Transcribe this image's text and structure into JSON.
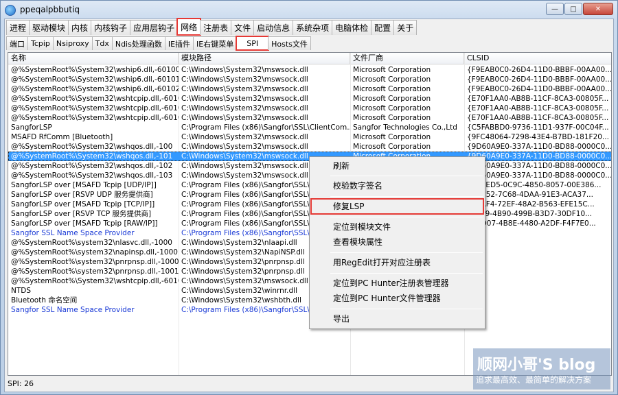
{
  "window": {
    "title": "ppeqalpbbutiq",
    "minimize": "—",
    "maximize": "□",
    "close": "✕"
  },
  "main_tabs": [
    {
      "label": "进程"
    },
    {
      "label": "驱动模块"
    },
    {
      "label": "内核"
    },
    {
      "label": "内核钩子"
    },
    {
      "label": "应用层钩子"
    },
    {
      "label": "网络"
    },
    {
      "label": "注册表"
    },
    {
      "label": "文件"
    },
    {
      "label": "启动信息"
    },
    {
      "label": "系统杂项"
    },
    {
      "label": "电脑体检"
    },
    {
      "label": "配置"
    },
    {
      "label": "关于"
    }
  ],
  "network_tabs": [
    {
      "label": "端口"
    },
    {
      "label": "Tcpip"
    },
    {
      "label": "Nsiproxy"
    },
    {
      "label": "Tdx"
    },
    {
      "label": "Ndis处理函数"
    },
    {
      "label": "IE插件"
    },
    {
      "label": "IE右键菜单"
    },
    {
      "label": "SPI"
    },
    {
      "label": "Hosts文件"
    }
  ],
  "table": {
    "columns": [
      "名称",
      "模块路径",
      "文件厂商",
      "CLSID"
    ],
    "rows": [
      [
        "@%SystemRoot%\\System32\\wship6.dll,-60100",
        "C:\\Windows\\System32\\mswsock.dll",
        "Microsoft Corporation",
        "{F9EAB0C0-26D4-11D0-BBBF-00AA00..."
      ],
      [
        "@%SystemRoot%\\System32\\wship6.dll,-60101",
        "C:\\Windows\\System32\\mswsock.dll",
        "Microsoft Corporation",
        "{F9EAB0C0-26D4-11D0-BBBF-00AA00..."
      ],
      [
        "@%SystemRoot%\\System32\\wship6.dll,-60102",
        "C:\\Windows\\System32\\mswsock.dll",
        "Microsoft Corporation",
        "{F9EAB0C0-26D4-11D0-BBBF-00AA00..."
      ],
      [
        "@%SystemRoot%\\System32\\wshtcpip.dll,-60100",
        "C:\\Windows\\System32\\mswsock.dll",
        "Microsoft Corporation",
        "{E70F1AA0-AB8B-11CF-8CA3-00805F..."
      ],
      [
        "@%SystemRoot%\\System32\\wshtcpip.dll,-60101",
        "C:\\Windows\\System32\\mswsock.dll",
        "Microsoft Corporation",
        "{E70F1AA0-AB8B-11CF-8CA3-00805F..."
      ],
      [
        "@%SystemRoot%\\System32\\wshtcpip.dll,-60102",
        "C:\\Windows\\System32\\mswsock.dll",
        "Microsoft Corporation",
        "{E70F1AA0-AB8B-11CF-8CA3-00805F..."
      ],
      [
        "SangforLSP",
        "C:\\Program Files (x86)\\Sangfor\\SSL\\ClientCom...",
        "Sangfor Technologies Co.,Ltd",
        "{C5FABBD0-9736-11D1-937F-00C04F..."
      ],
      [
        "MSAFD RfComm [Bluetooth]",
        "C:\\Windows\\System32\\mswsock.dll",
        "Microsoft Corporation",
        "{9FC48064-7298-43E4-B7BD-181F20..."
      ],
      [
        "@%SystemRoot%\\System32\\wshqos.dll,-100",
        "C:\\Windows\\System32\\mswsock.dll",
        "Microsoft Corporation",
        "{9D60A9E0-337A-11D0-BD88-0000C0..."
      ],
      [
        "@%SystemRoot%\\System32\\wshqos.dll,-101",
        "C:\\Windows\\System32\\mswsock.dll",
        "Microsoft Corporation",
        "{9D60A9E0-337A-11D0-BD88-0000C0..."
      ],
      [
        "@%SystemRoot%\\System32\\wshqos.dll,-102",
        "C:\\Windows\\System32\\mswsock.dll",
        "",
        "{9D60A9E0-337A-11D0-BD88-0000C0..."
      ],
      [
        "@%SystemRoot%\\System32\\wshqos.dll,-103",
        "C:\\Windows\\System32\\mswsock.dll",
        "",
        "{9D60A9E0-337A-11D0-BD88-0000C0..."
      ],
      [
        "SangforLSP over [MSAFD Tcpip [UDP/IP]]",
        "C:\\Program Files (x86)\\Sangfor\\SSL\\C",
        "",
        "{24CED5-0C9C-4850-8057-00E386..."
      ],
      [
        "SangforLSP over [RSVP UDP 服务提供商]",
        "C:\\Program Files (x86)\\Sangfor\\SSL\\C",
        "",
        "{3AC52-7C68-4DAA-91E3-ACA37..."
      ],
      [
        "SangforLSP over [MSAFD Tcpip [TCP/IP]]",
        "C:\\Program Files (x86)\\Sangfor\\SSL\\C",
        "",
        "{4BAF4-72EF-48A2-B563-EFE15C..."
      ],
      [
        "SangforLSP over [RSVP TCP 服务提供商]",
        "C:\\Program Files (x86)\\Sangfor\\SSL\\C",
        "",
        "{1E69-4B90-499B-B3D7-30DF10..."
      ],
      [
        "SangforLSP over [MSAFD Tcpip [RAW/IP]]",
        "C:\\Program Files (x86)\\Sangfor\\SSL\\C",
        "",
        "{C4D07-4B8E-4480-A2DF-F4F7E0..."
      ],
      [
        "Sangfor SSL Name Space Provider",
        "C:\\Program Files (x86)\\Sangfor\\SSL\\C",
        "",
        ""
      ],
      [
        "@%SystemRoot%\\system32\\nlasvc.dll,-1000",
        "C:\\Windows\\System32\\nlaapi.dll",
        "",
        ""
      ],
      [
        "@%SystemRoot%\\system32\\napinsp.dll,-1000",
        "C:\\Windows\\System32\\NapiNSP.dll",
        "",
        ""
      ],
      [
        "@%SystemRoot%\\system32\\pnrpnsp.dll,-1000",
        "C:\\Windows\\System32\\pnrpnsp.dll",
        "",
        ""
      ],
      [
        "@%SystemRoot%\\system32\\pnrpnsp.dll,-1001",
        "C:\\Windows\\System32\\pnrpnsp.dll",
        "",
        ""
      ],
      [
        "@%SystemRoot%\\System32\\wshtcpip.dll,-60103",
        "C:\\Windows\\System32\\mswsock.dll",
        "",
        ""
      ],
      [
        "NTDS",
        "C:\\Windows\\System32\\winrnr.dll",
        "",
        ""
      ],
      [
        "Bluetooth 命名空间",
        "C:\\Windows\\System32\\wshbth.dll",
        "",
        ""
      ],
      [
        "Sangfor SSL Name Space Provider",
        "C:\\Program Files (x86)\\Sangfor\\SSL\\C",
        "",
        ""
      ]
    ]
  },
  "context_menu": {
    "refresh": "刷新",
    "verify_signature": "校验数字签名",
    "repair_lsp": "修复LSP",
    "locate_module_file": "定位到模块文件",
    "view_module_properties": "查看模块属性",
    "open_in_regedit": "用RegEdit打开对应注册表",
    "locate_reg_manager": "定位到PC Hunter注册表管理器",
    "locate_file_manager": "定位到PC Hunter文件管理器",
    "export": "导出"
  },
  "status": {
    "text": "SPI: 26"
  },
  "watermark": {
    "title": "顺网小哥'S blog",
    "subtitle": "追求最高效、最简单的解决方案"
  },
  "colors": {
    "highlight_outline": "#e53935",
    "selected_row": "#3399ff",
    "sangfor_text": "#1a3ad6"
  }
}
